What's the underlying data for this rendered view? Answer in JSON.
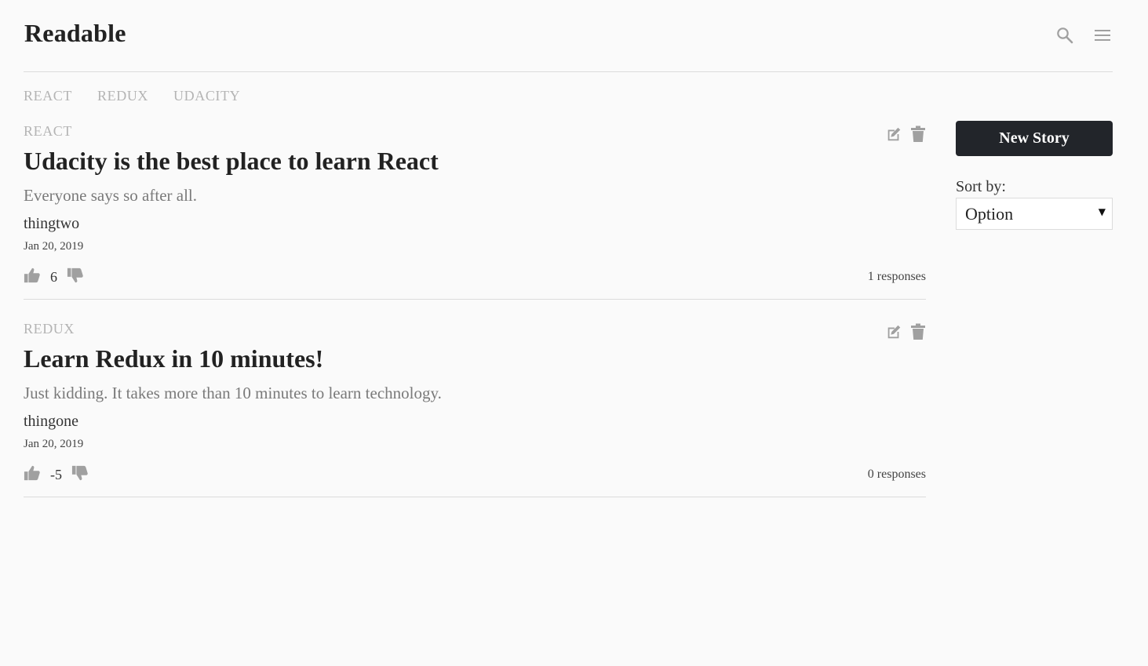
{
  "app": {
    "title": "Readable"
  },
  "header": {
    "icons": [
      "search-icon",
      "menu-icon"
    ]
  },
  "nav": {
    "categories": [
      "REACT",
      "REDUX",
      "UDACITY"
    ]
  },
  "posts": [
    {
      "category": "REACT",
      "title": "Udacity is the best place to learn React",
      "body": "Everyone says so after all.",
      "author": "thingtwo",
      "date": "Jan 20, 2019",
      "score": "6",
      "responses": "1 responses"
    },
    {
      "category": "REDUX",
      "title": "Learn Redux in 10 minutes!",
      "body": "Just kidding. It takes more than 10 minutes to learn technology.",
      "author": "thingone",
      "date": "Jan 20, 2019",
      "score": "-5",
      "responses": "0 responses"
    }
  ],
  "sidebar": {
    "new_story_label": "New Story",
    "sort_label": "Sort by:",
    "sort_value": "Option"
  },
  "colors": {
    "button_bg": "#22252a",
    "muted": "#b4b4b4",
    "icon": "#a0a0a0"
  }
}
